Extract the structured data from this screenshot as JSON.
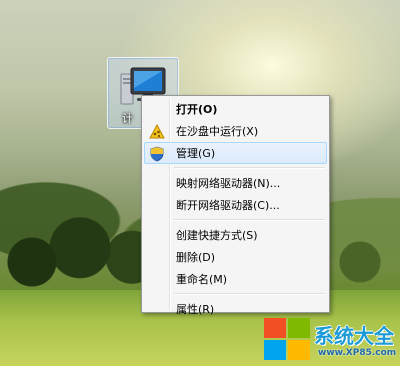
{
  "desktop": {
    "icon": {
      "label": "计",
      "icon_name": "computer-icon"
    }
  },
  "context_menu": {
    "items": [
      {
        "label": "打开(O)",
        "bold": true,
        "icon": null
      },
      {
        "label": "在沙盘中运行(X)",
        "icon": "sandbox-icon"
      },
      {
        "label": "管理(G)",
        "icon": "shield-icon",
        "highlighted": true
      },
      {
        "label": "映射网络驱动器(N)..."
      },
      {
        "label": "断开网络驱动器(C)..."
      },
      {
        "label": "创建快捷方式(S)"
      },
      {
        "label": "删除(D)"
      },
      {
        "label": "重命名(M)"
      },
      {
        "label": "属性(R)"
      }
    ]
  },
  "watermark": {
    "title": "系统大全",
    "url": "www.XP85.com",
    "colors": [
      "#f25022",
      "#7fba00",
      "#00a4ef",
      "#ffb900"
    ]
  }
}
